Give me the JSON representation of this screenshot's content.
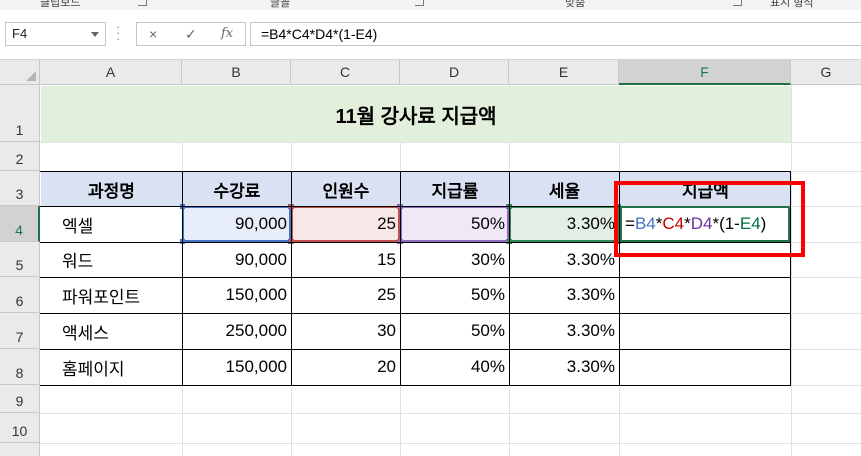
{
  "ribbon": {
    "groups": [
      "클립보드",
      "글꼴",
      "맞춤",
      "표시 형식"
    ]
  },
  "formula_bar": {
    "name_box": "F4",
    "cancel_icon": "×",
    "enter_icon": "✓",
    "fx_icon": "fx",
    "formula": "=B4*C4*D4*(1-E4)"
  },
  "columns": [
    "A",
    "B",
    "C",
    "D",
    "E",
    "F",
    "G"
  ],
  "rows": [
    "1",
    "2",
    "3",
    "4",
    "5",
    "6",
    "7",
    "8",
    "9",
    "10"
  ],
  "sheet": {
    "title": "11월 강사료 지급액",
    "headers": [
      "과정명",
      "수강료",
      "인원수",
      "지급률",
      "세율",
      "지급액"
    ],
    "data": [
      [
        "엑셀",
        "90,000",
        "25",
        "50%",
        "3.30%"
      ],
      [
        "워드",
        "90,000",
        "15",
        "30%",
        "3.30%"
      ],
      [
        "파워포인트",
        "150,000",
        "25",
        "50%",
        "3.30%"
      ],
      [
        "액세스",
        "250,000",
        "30",
        "50%",
        "3.30%"
      ],
      [
        "홈페이지",
        "150,000",
        "20",
        "40%",
        "3.30%"
      ]
    ],
    "editing_cell": {
      "parts": [
        "=",
        "B4",
        "*",
        "C4",
        "*",
        "D4",
        "*(1-",
        "E4",
        ")"
      ]
    }
  },
  "colors": {
    "accent": "#217346",
    "title_fill": "#e2efda",
    "header_fill": "#d9e1f2",
    "ref_b": "#4472c4",
    "ref_c": "#c00000",
    "ref_d": "#7030a0",
    "ref_e": "#00703c",
    "annotation": "#ff0000"
  }
}
